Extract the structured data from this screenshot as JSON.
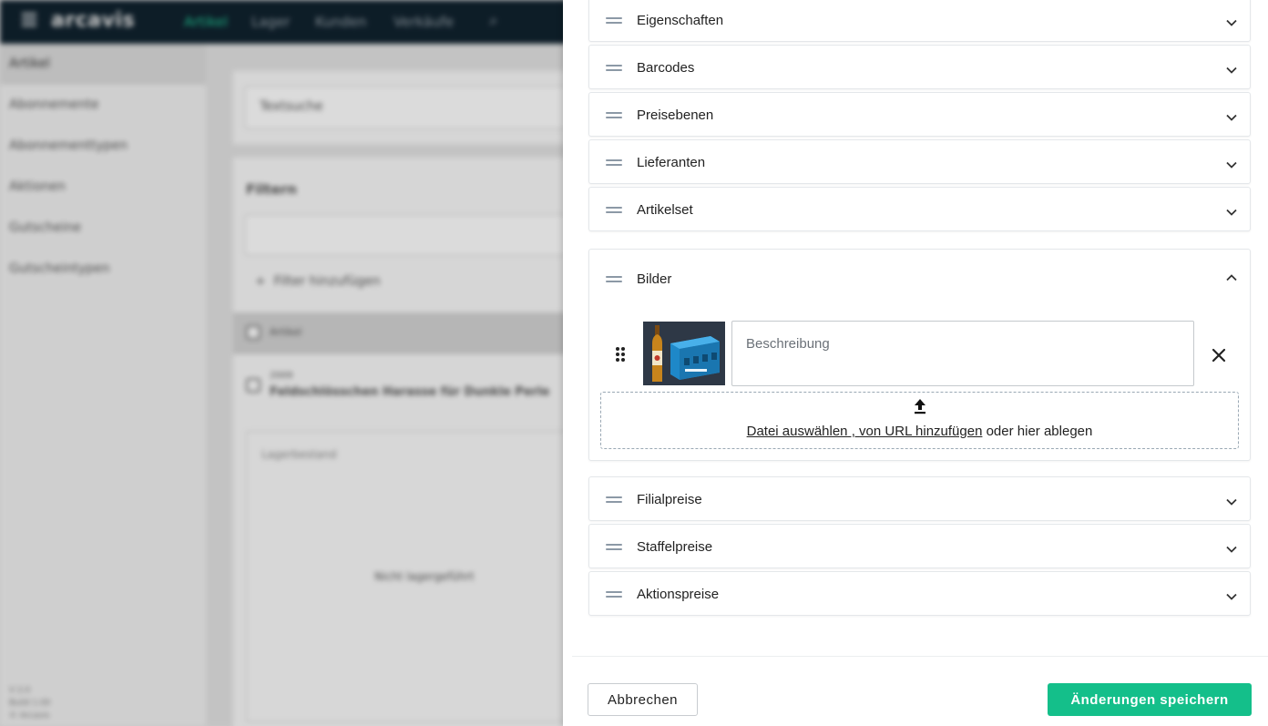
{
  "background": {
    "app_name": "arcavis",
    "nav": [
      "Artikel",
      "Lager",
      "Kunden",
      "Verkäufe"
    ],
    "sidebar": [
      "Artikel",
      "Abonnemente",
      "Abonnementtypen",
      "Aktionen",
      "Gutscheine",
      "Gutscheintypen"
    ],
    "search_placeholder": "Textsuche",
    "filter_heading": "Filtern",
    "add_filter": "Filter hinzufügen",
    "list_header": "Artikel",
    "row_number": "2009",
    "row_title": "Feldschlösschen Harasse für Dunkle Perle",
    "stock_label": "Lagerbestand",
    "stock_value": "Nicht lagergeführt",
    "footer_lines": [
      "V 2.0",
      "Build 1.00",
      "© Arcavis"
    ]
  },
  "drawer": {
    "panels": [
      {
        "title": "Eigenschaften"
      },
      {
        "title": "Barcodes"
      },
      {
        "title": "Preisebenen"
      },
      {
        "title": "Lieferanten"
      },
      {
        "title": "Artikelset"
      }
    ],
    "images_panel": {
      "title": "Bilder",
      "description_placeholder": "Beschreibung",
      "drop_link_file": "Datei auswählen",
      "drop_link_sep": " , ",
      "drop_link_url": "von URL hinzufügen",
      "drop_suffix": " oder hier ablegen"
    },
    "panels_bottom": [
      {
        "title": "Filialpreise"
      },
      {
        "title": "Staffelpreise"
      },
      {
        "title": "Aktionspreise"
      }
    ],
    "cancel_label": "Abbrechen",
    "save_label": "Änderungen speichern"
  },
  "colors": {
    "accent": "#14bf8a",
    "topbar": "#10222e",
    "handle": "#8c99a6"
  }
}
